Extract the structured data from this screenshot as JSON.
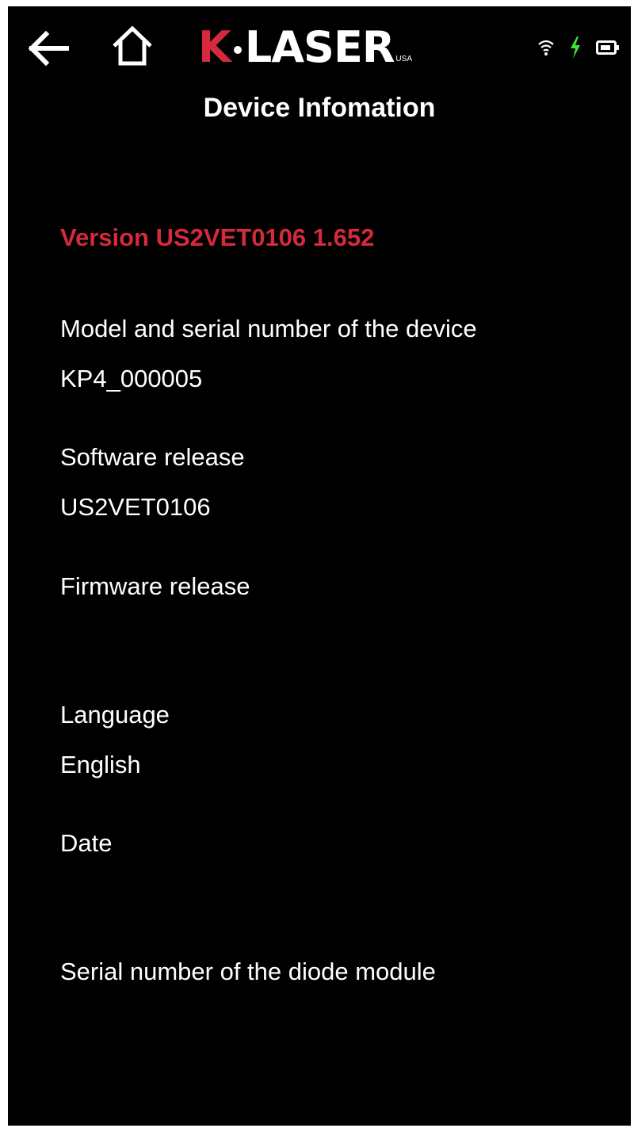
{
  "header": {
    "title": "Device Infomation",
    "logo": {
      "brand_prefix": "K",
      "brand_rest": "LASER",
      "brand_suffix": "USA"
    },
    "icons": {
      "back": "back-arrow-icon",
      "home": "home-icon",
      "wifi": "wifi-icon",
      "charging": "charging-bolt-icon",
      "battery": "battery-icon"
    }
  },
  "version_line": {
    "text": "Version US2VET0106   1.652"
  },
  "fields": [
    {
      "label": "Model and serial number of the device",
      "value": "KP4_000005"
    },
    {
      "label": "Software release",
      "value": "US2VET0106"
    },
    {
      "label": "Firmware release",
      "value": ""
    },
    {
      "label": "Language",
      "value": "English"
    },
    {
      "label": "Date",
      "value": ""
    },
    {
      "label": "Serial number of the diode module",
      "value": ""
    }
  ],
  "colors": {
    "background": "#000000",
    "text": "#ffffff",
    "accent_red": "#d42a3c",
    "charging_green": "#3fe23f"
  }
}
